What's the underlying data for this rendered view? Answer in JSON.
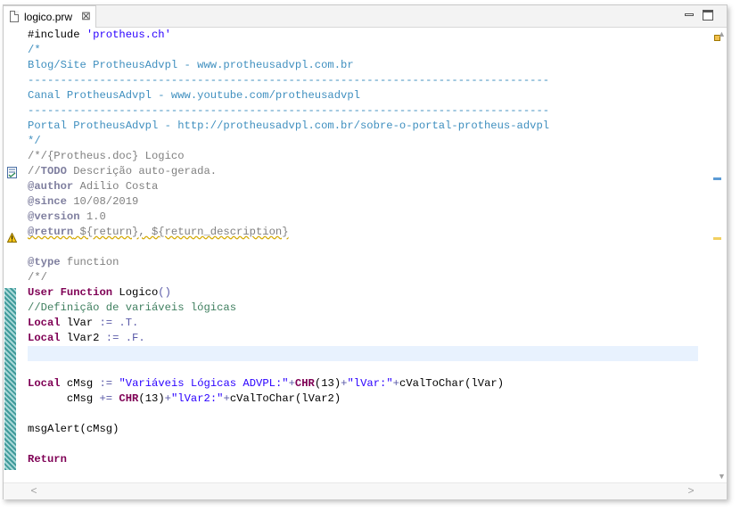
{
  "tab": {
    "title": "logico.prw",
    "close_glyph": "⊠"
  },
  "window_controls": {
    "minimize": "minimize-icon",
    "maximize": "maximize-icon"
  },
  "code_lines": [
    [
      {
        "t": "#include ",
        "c": "ident"
      },
      {
        "t": "'protheus.ch'",
        "c": "str"
      }
    ],
    [
      {
        "t": "/*",
        "c": "doc-blue"
      }
    ],
    [
      {
        "t": "Blog/Site ProtheusAdvpl - www.protheusadvpl.com.br",
        "c": "doc-blue"
      }
    ],
    [
      {
        "t": "--------------------------------------------------------------------------------",
        "c": "doc-blue"
      }
    ],
    [
      {
        "t": "Canal ProtheusAdvpl - www.youtube.com/protheusadvpl",
        "c": "doc-blue"
      }
    ],
    [
      {
        "t": "--------------------------------------------------------------------------------",
        "c": "doc-blue"
      }
    ],
    [
      {
        "t": "Portal ProtheusAdvpl - http://protheusadvpl.com.br/sobre-o-portal-protheus-advpl",
        "c": "doc-blue"
      }
    ],
    [
      {
        "t": "*/",
        "c": "doc-blue"
      }
    ],
    [
      {
        "t": "/*/{Protheus.doc} Logico",
        "c": "gray"
      }
    ],
    [
      {
        "t": "//",
        "c": "gray"
      },
      {
        "t": "TODO",
        "c": "tag"
      },
      {
        "t": " Descrição auto-gerada.",
        "c": "gray"
      }
    ],
    [
      {
        "t": "@author",
        "c": "tag"
      },
      {
        "t": " Adilio Costa",
        "c": "gray"
      }
    ],
    [
      {
        "t": "@since",
        "c": "tag"
      },
      {
        "t": " 10/08/2019",
        "c": "gray"
      }
    ],
    [
      {
        "t": "@version",
        "c": "tag"
      },
      {
        "t": " 1.0",
        "c": "gray"
      }
    ],
    [
      {
        "t": "@return",
        "c": "tag warn-u"
      },
      {
        "t": " ${return}, ${return_description}",
        "c": "gray warn-u"
      }
    ],
    [],
    [
      {
        "t": "@type",
        "c": "tag"
      },
      {
        "t": " function",
        "c": "gray"
      }
    ],
    [
      {
        "t": "/*/",
        "c": "gray"
      }
    ],
    [
      {
        "t": "User Function",
        "c": "kw"
      },
      {
        "t": " Logico",
        "c": "ident"
      },
      {
        "t": "()",
        "c": "op"
      }
    ],
    [
      {
        "t": "//Definição de variáveis lógicas",
        "c": "cmt"
      }
    ],
    [
      {
        "t": "Local",
        "c": "kw"
      },
      {
        "t": " lVar ",
        "c": "ident"
      },
      {
        "t": ":=",
        "c": "op"
      },
      {
        "t": " .T.",
        "c": "op"
      }
    ],
    [
      {
        "t": "Local",
        "c": "kw"
      },
      {
        "t": " lVar2 ",
        "c": "ident"
      },
      {
        "t": ":=",
        "c": "op"
      },
      {
        "t": " .F.",
        "c": "op"
      }
    ],
    [],
    [],
    [
      {
        "t": "Local",
        "c": "kw"
      },
      {
        "t": " cMsg ",
        "c": "ident"
      },
      {
        "t": ":=",
        "c": "op"
      },
      {
        "t": " ",
        "c": "ident"
      },
      {
        "t": "\"Variáveis Lógicas ADVPL:\"",
        "c": "str"
      },
      {
        "t": "+",
        "c": "op"
      },
      {
        "t": "CHR",
        "c": "kw"
      },
      {
        "t": "(13)",
        "c": "ident"
      },
      {
        "t": "+",
        "c": "op"
      },
      {
        "t": "\"lVar:\"",
        "c": "str"
      },
      {
        "t": "+",
        "c": "op"
      },
      {
        "t": "cValToChar(lVar)",
        "c": "ident"
      }
    ],
    [
      {
        "t": "      cMsg ",
        "c": "ident"
      },
      {
        "t": "+=",
        "c": "op"
      },
      {
        "t": " ",
        "c": "ident"
      },
      {
        "t": "CHR",
        "c": "kw"
      },
      {
        "t": "(13)",
        "c": "ident"
      },
      {
        "t": "+",
        "c": "op"
      },
      {
        "t": "\"lVar2:\"",
        "c": "str"
      },
      {
        "t": "+",
        "c": "op"
      },
      {
        "t": "cValToChar(lVar2)",
        "c": "ident"
      }
    ],
    [],
    [
      {
        "t": "msgAlert(cMsg)",
        "c": "ident"
      }
    ],
    [],
    [
      {
        "t": "Return",
        "c": "kw"
      }
    ]
  ],
  "current_line_index": 21,
  "gutter_icons": {
    "task": "task-icon",
    "warning": "warning-icon"
  },
  "scroll": {
    "up": "▲",
    "down": "▼",
    "left": "<",
    "right": ">"
  }
}
